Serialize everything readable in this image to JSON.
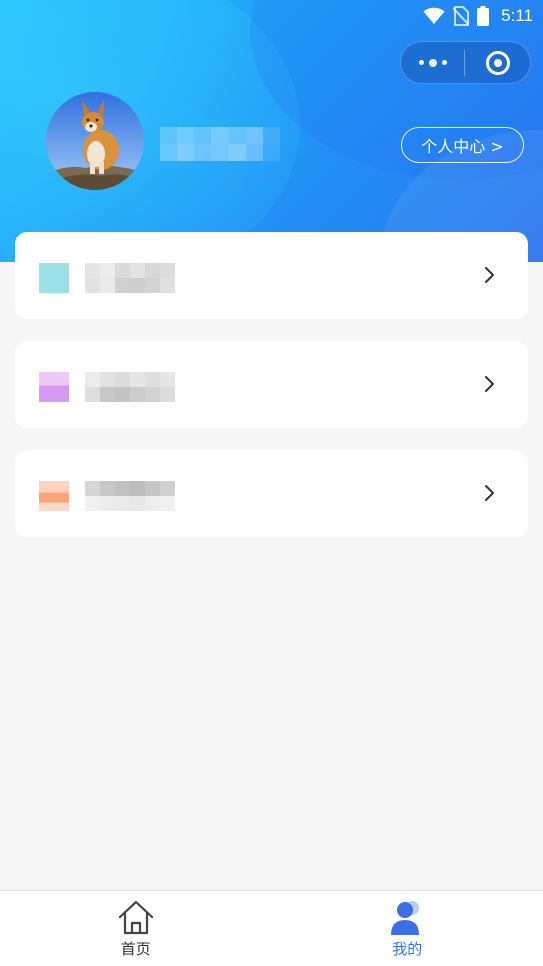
{
  "status_bar": {
    "time": "5:11",
    "icons": [
      "wifi-icon",
      "no-sim-icon",
      "battery-icon"
    ]
  },
  "capsule": {
    "more_icon": "more-dots-icon",
    "close_icon": "close-target-icon"
  },
  "profile": {
    "avatar": "corgi-dog-photo",
    "personal_center_label": "个人中心 >"
  },
  "menu": {
    "items": [
      {
        "icon_color": "#9be0e6",
        "chevron": "chevron-right-icon"
      },
      {
        "icon_color": "#d9a6f2",
        "chevron": "chevron-right-icon"
      },
      {
        "icon_color": "#ffa982",
        "chevron": "chevron-right-icon"
      }
    ]
  },
  "tabbar": {
    "tabs": [
      {
        "label": "首页",
        "icon": "home-icon",
        "active": false
      },
      {
        "label": "我的",
        "icon": "user-icon",
        "active": true
      }
    ]
  },
  "colors": {
    "header_gradient_start": "#25c2fb",
    "header_gradient_end": "#2a74f0",
    "active_tab": "#3a73e8",
    "background": "#f6f6f6"
  }
}
